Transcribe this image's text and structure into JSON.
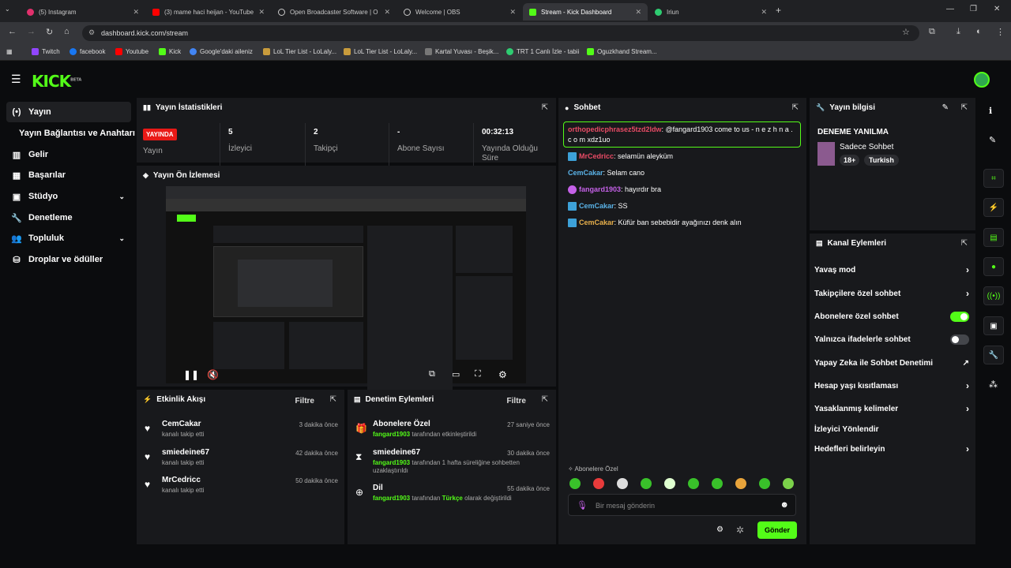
{
  "browser": {
    "tabs": [
      {
        "title": "(5) Instagram",
        "color": "#e1306c"
      },
      {
        "title": "(3) mame haci heijan - YouTube",
        "color": "#ff0000"
      },
      {
        "title": "Open Broadcaster Software | O",
        "color": "#cccccc"
      },
      {
        "title": "Welcome | OBS",
        "color": "#cccccc"
      },
      {
        "title": "Stream - Kick Dashboard",
        "color": "#53fc18"
      },
      {
        "title": "Iriun",
        "color": "#2ecc71"
      }
    ],
    "url": "dashboard.kick.com/stream",
    "bookmarks": [
      "Twitch",
      "facebook",
      "Youtube",
      "Kick",
      "Google'daki aileniz",
      "LoL Tier List - LoLaly...",
      "LoL Tier List - LoLaly...",
      "Kartal Yuvası - Beşik...",
      "TRT 1 Canlı İzle - tabii",
      "Oguzkhand Stream..."
    ]
  },
  "brand": {
    "logo": "KICK",
    "beta": "BETA",
    "accent": "#53fc18"
  },
  "sidebar": {
    "items": [
      {
        "label": "Yayın",
        "icon": "(•)"
      },
      {
        "label": "Yayın Bağlantısı ve Anahtarı",
        "icon": ""
      },
      {
        "label": "Gelir",
        "icon": "▥"
      },
      {
        "label": "Başarılar",
        "icon": "▦"
      },
      {
        "label": "Stüdyo",
        "icon": "▣"
      },
      {
        "label": "Denetleme",
        "icon": "🔧"
      },
      {
        "label": "Topluluk",
        "icon": "👥"
      },
      {
        "label": "Droplar ve ödüller",
        "icon": "⛁"
      }
    ]
  },
  "stats": {
    "title": "Yayın İstatistikleri",
    "live_label": "YAYINDA",
    "live_sub": "Yayın",
    "viewers": {
      "value": "5",
      "label": "İzleyici"
    },
    "followers": {
      "value": "2",
      "label": "Takipçi"
    },
    "subs": {
      "value": "-",
      "label": "Abone Sayısı"
    },
    "duration": {
      "value": "00:32:13",
      "label": "Yayında Olduğu Süre"
    }
  },
  "preview": {
    "title": "Yayın Ön İzlemesi"
  },
  "activity": {
    "title": "Etkinlik Akışı",
    "filter": "Filtre",
    "items": [
      {
        "name": "CemCakar",
        "sub": "kanalı takip etti",
        "time": "3 dakika önce"
      },
      {
        "name": "smiedeine67",
        "sub": "kanalı takip etti",
        "time": "42 dakika önce"
      },
      {
        "name": "MrCedricc",
        "sub": "kanalı takip etti",
        "time": "50 dakika önce"
      }
    ]
  },
  "modlog": {
    "title": "Denetim Eylemleri",
    "filter": "Filtre",
    "items": [
      {
        "name": "Abonelere Özel",
        "user": "fangard1903",
        "rest": " tarafından etkinleştirildi",
        "extra": "",
        "extra2": "",
        "time": "27 saniye önce"
      },
      {
        "name": "smiedeine67",
        "user": "fangard1903",
        "rest": " tarafından 1 hafta süreliğine sohbetten",
        "extra": "uzaklaştırıldı",
        "extra2": "",
        "time": "30 dakika önce"
      },
      {
        "name": "Dil",
        "user": "fangard1903",
        "rest": " tarafından ",
        "extra": "Türkçe",
        "extra2": " olarak değiştirildi",
        "time": "55 dakika önce"
      }
    ]
  },
  "chat": {
    "title": "Sohbet",
    "pinned_user": "orthopedicphrasez5tzd2ldw",
    "pinned_text": ": @fangard1903 come to us - n e z h n a . c o m xdz1uo",
    "messages": [
      {
        "user": "MrCedricc",
        "text": ": selamün aleyküm",
        "color": "#e84b65"
      },
      {
        "user": "CemCakar",
        "text": ": Selam cano",
        "color": "#5ab3e8"
      },
      {
        "user": "fangard1903",
        "text": ": hayırdır bra",
        "color": "#c561e8"
      },
      {
        "user": "CemCakar",
        "text": ": SS",
        "color": "#5ab3e8"
      },
      {
        "user": "CemCakar",
        "text": ": Küfür ban sebebidir ayağınızı denk alın",
        "color": "#e8b04b"
      }
    ],
    "mode_label": "Abonelere Özel",
    "input_placeholder": "Bir mesaj gönderin",
    "send_label": "Gönder"
  },
  "streaminfo": {
    "title": "Yayın bilgisi",
    "stream_title": "DENEME YANILMA",
    "category": "Sadece Sohbet",
    "tags": [
      "18+",
      "Turkish"
    ]
  },
  "channel_actions": {
    "title": "Kanal Eylemleri",
    "items": [
      {
        "label": "Yavaş mod",
        "kind": "arrow"
      },
      {
        "label": "Takipçilere özel sohbet",
        "kind": "arrow"
      },
      {
        "label": "Abonelere özel sohbet",
        "kind": "toggle-on"
      },
      {
        "label": "Yalnızca ifadelerle sohbet",
        "kind": "toggle-off"
      },
      {
        "label": "Yapay Zeka ile Sohbet Denetimi",
        "kind": "external"
      },
      {
        "label": "Hesap yaşı kısıtlaması",
        "kind": "arrow"
      },
      {
        "label": "Yasaklanmış kelimeler",
        "kind": "arrow"
      },
      {
        "label": "İzleyici Yönlendir",
        "kind": "none"
      },
      {
        "label": "Hedefleri belirleyin",
        "kind": "arrow"
      }
    ]
  }
}
